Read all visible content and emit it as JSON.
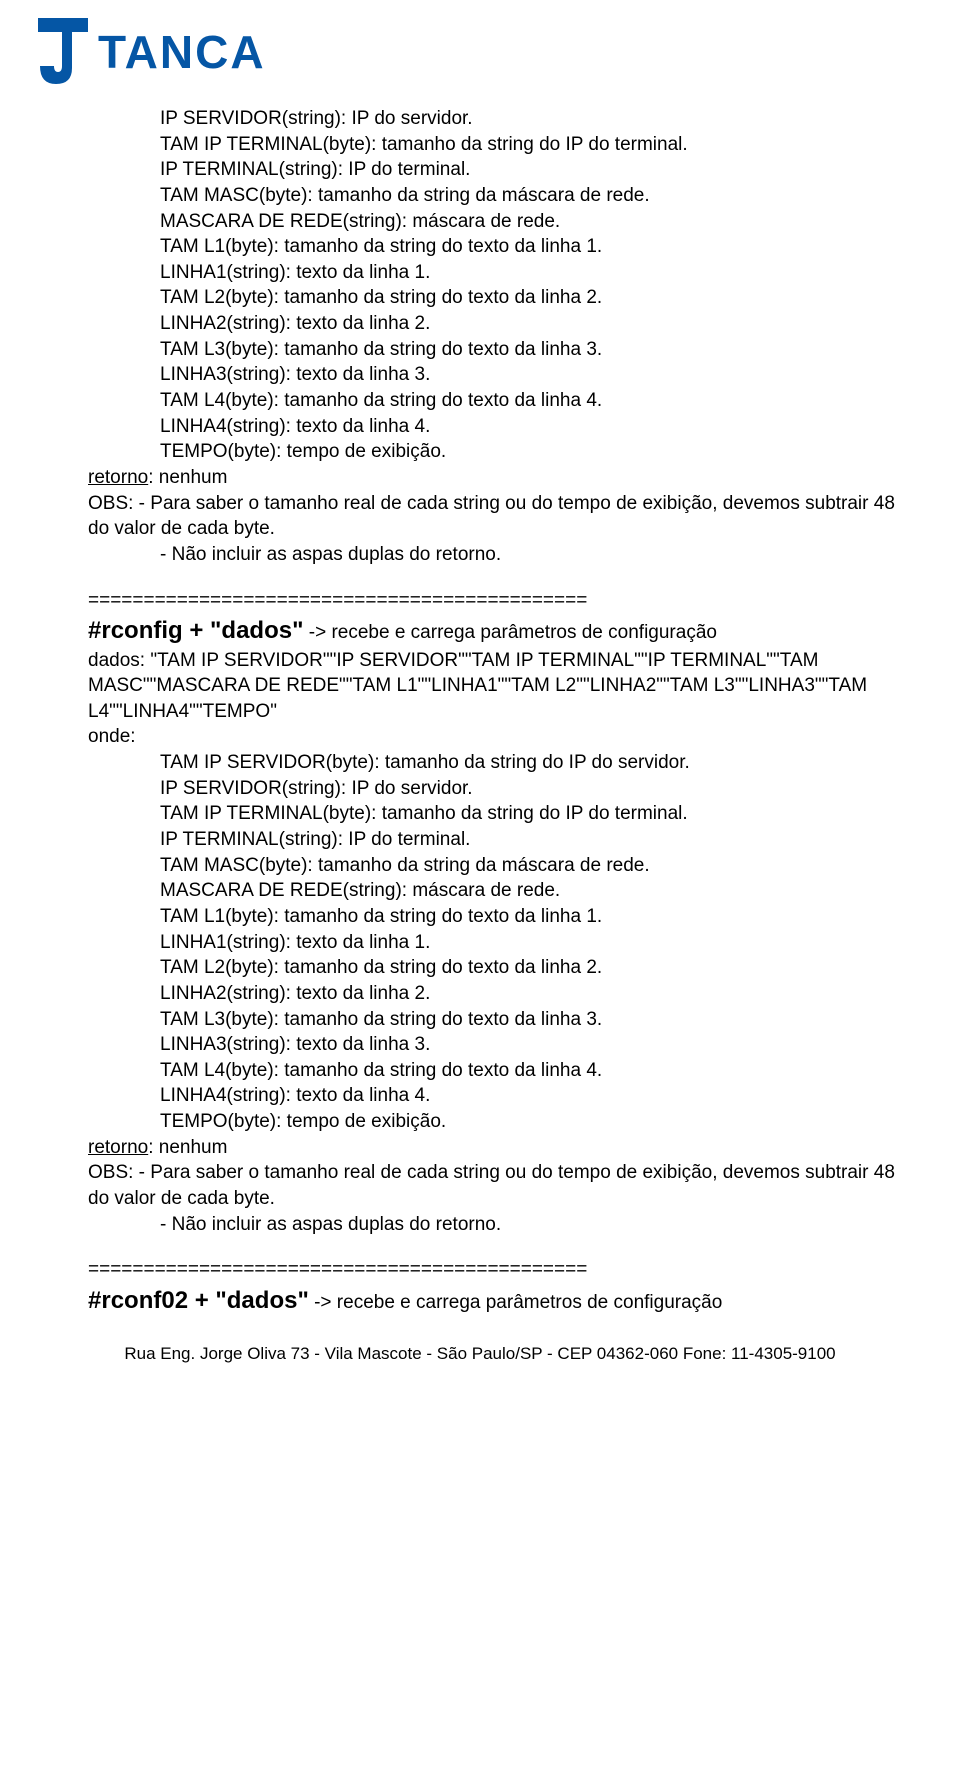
{
  "logo": {
    "text": "TANCA"
  },
  "block1": {
    "lines": [
      "IP SERVIDOR(string): IP do servidor.",
      "TAM IP TERMINAL(byte): tamanho da string do IP do terminal.",
      "IP TERMINAL(string): IP do terminal.",
      "TAM MASC(byte): tamanho da string da máscara de rede.",
      "MASCARA DE REDE(string): máscara de rede.",
      "TAM L1(byte): tamanho da string do texto da linha 1.",
      "LINHA1(string): texto da linha 1.",
      "TAM L2(byte): tamanho da string do texto da linha 2.",
      "LINHA2(string): texto da linha 2.",
      "TAM L3(byte): tamanho da string do texto da linha 3.",
      "LINHA3(string): texto da linha 3.",
      "TAM L4(byte): tamanho da string do texto da linha 4.",
      "LINHA4(string): texto da linha 4.",
      "TEMPO(byte): tempo de exibição."
    ],
    "retorno_label": "retorno",
    "retorno_rest": ": nenhum",
    "obs1": "OBS:   - Para saber o tamanho real de cada string ou do tempo de exibição, devemos subtrair 48 do valor de cada byte.",
    "obs2": "- Não incluir as aspas duplas do retorno."
  },
  "sep": "=============================================",
  "block2": {
    "cmd": "#rconfig + \"dados\"",
    "cmd_desc": " -> recebe e carrega parâmetros de configuração",
    "dados": "dados: \"TAM IP SERVIDOR\"\"IP SERVIDOR\"\"TAM IP TERMINAL\"\"IP TERMINAL\"\"TAM MASC\"\"MASCARA DE REDE\"\"TAM L1\"\"LINHA1\"\"TAM L2\"\"LINHA2\"\"TAM L3\"\"LINHA3\"\"TAM L4\"\"LINHA4\"\"TEMPO\"",
    "onde": "onde:",
    "lines": [
      "TAM IP SERVIDOR(byte): tamanho da string do IP do servidor.",
      "IP SERVIDOR(string): IP do servidor.",
      "TAM IP TERMINAL(byte): tamanho da string do IP do terminal.",
      "IP TERMINAL(string): IP do terminal.",
      "TAM MASC(byte): tamanho da string da máscara de rede.",
      "MASCARA DE REDE(string): máscara de rede.",
      "TAM L1(byte): tamanho da string do texto da linha 1.",
      "LINHA1(string): texto da linha 1.",
      "TAM L2(byte): tamanho da string do texto da linha 2.",
      "LINHA2(string): texto da linha 2.",
      "TAM L3(byte): tamanho da string do texto da linha 3.",
      "LINHA3(string): texto da linha 3.",
      "TAM L4(byte): tamanho da string do texto da linha 4.",
      "LINHA4(string): texto da linha 4.",
      "TEMPO(byte): tempo de exibição."
    ],
    "retorno_label": "retorno",
    "retorno_rest": ": nenhum",
    "obs1": "OBS:   - Para saber o tamanho real de cada string ou do tempo de exibição, devemos subtrair 48 do valor de cada byte.",
    "obs2": "- Não incluir as aspas duplas do retorno."
  },
  "block3": {
    "cmd": "#rconf02 + \"dados\"",
    "cmd_desc": " -> recebe e carrega parâmetros de configuração"
  },
  "footer": "Rua Eng. Jorge Oliva 73 - Vila Mascote - São Paulo/SP - CEP 04362-060 Fone: 11-4305-9100"
}
